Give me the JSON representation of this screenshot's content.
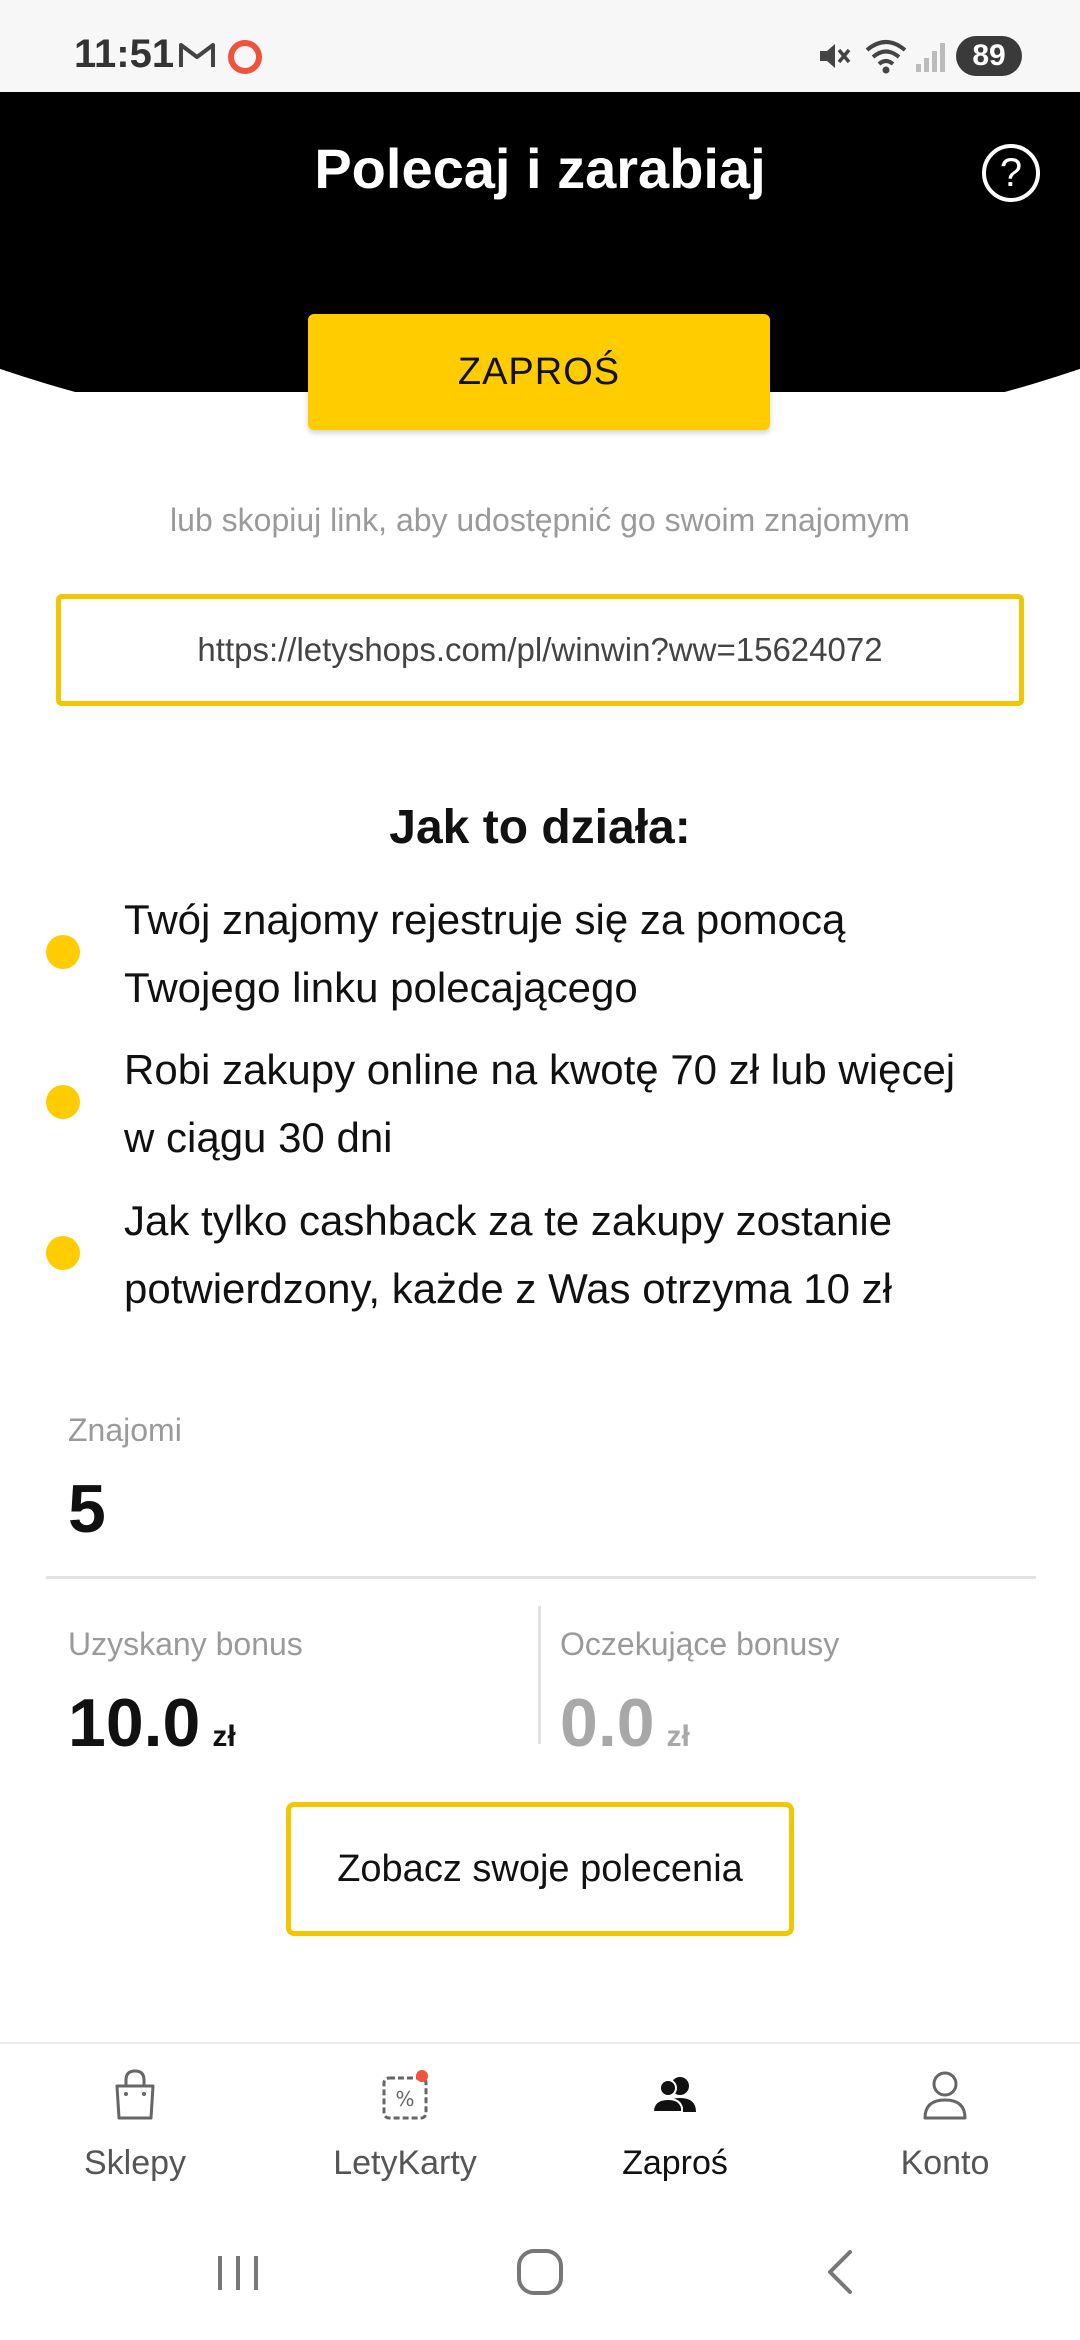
{
  "status_bar": {
    "time": "11:51",
    "battery": "89"
  },
  "header": {
    "title": "Polecaj i zarabiaj",
    "help_label": "?"
  },
  "invite_button": "ZAPROŚ",
  "copy_hint": "lub skopiuj link, aby udostępnić go swoim znajomym",
  "referral_link": "https://letyshops.com/pl/winwin?ww=15624072",
  "how_it_works": {
    "title": "Jak to działa:",
    "steps": [
      {
        "line1": "Twój znajomy rejestruje się za pomocą",
        "line2": "Twojego linku polecającego"
      },
      {
        "line1": "Robi zakupy online na kwotę 70 zł lub więcej",
        "line2": "w ciągu 30 dni"
      },
      {
        "line1": "Jak tylko cashback za te zakupy zostanie",
        "line2": "potwierdzony, każde z Was otrzyma 10 zł"
      }
    ]
  },
  "stats": {
    "friends_label": "Znajomi",
    "friends_value": "5",
    "earned_label": "Uzyskany bonus",
    "earned_value": "10.0",
    "earned_unit": "zł",
    "pending_label": "Oczekujące bonusy",
    "pending_value": "0.0",
    "pending_unit": "zł"
  },
  "see_referrals_button": "Zobacz swoje polecenia",
  "bottom_nav": {
    "items": [
      {
        "label": "Sklepy",
        "icon": "shopping-bag-icon"
      },
      {
        "label": "LetyKarty",
        "icon": "coupon-card-icon"
      },
      {
        "label": "Zaproś",
        "icon": "friends-icon"
      },
      {
        "label": "Konto",
        "icon": "user-icon"
      }
    ],
    "active_index": 2
  },
  "colors": {
    "accent": "#ffcc00",
    "header_bg": "#000000",
    "notification_dot": "#f0533c"
  }
}
